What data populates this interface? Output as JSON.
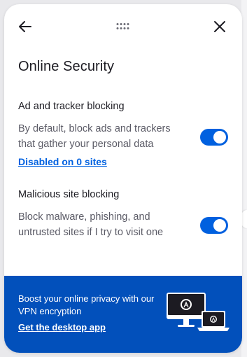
{
  "header": {
    "back_icon": "arrow-left-icon",
    "drag_icon": "grip-dots-icon",
    "close_icon": "close-icon"
  },
  "page": {
    "title": "Online Security"
  },
  "ad_blocking": {
    "heading": "Ad and tracker blocking",
    "description": "By default, block ads and trackers that gather your personal data",
    "link": "Disabled on 0 sites",
    "enabled": true
  },
  "malicious_blocking": {
    "heading": "Malicious site blocking",
    "description": "Block malware, phishing, and untrusted sites if I try to visit one",
    "enabled": true
  },
  "promo": {
    "text": "Boost your online privacy with our VPN encryption",
    "cta": "Get the desktop app",
    "illustration": "monitor-laptop-icon"
  },
  "colors": {
    "accent": "#0060df",
    "promo_background": "#0250bb",
    "link": "#0061e0"
  }
}
